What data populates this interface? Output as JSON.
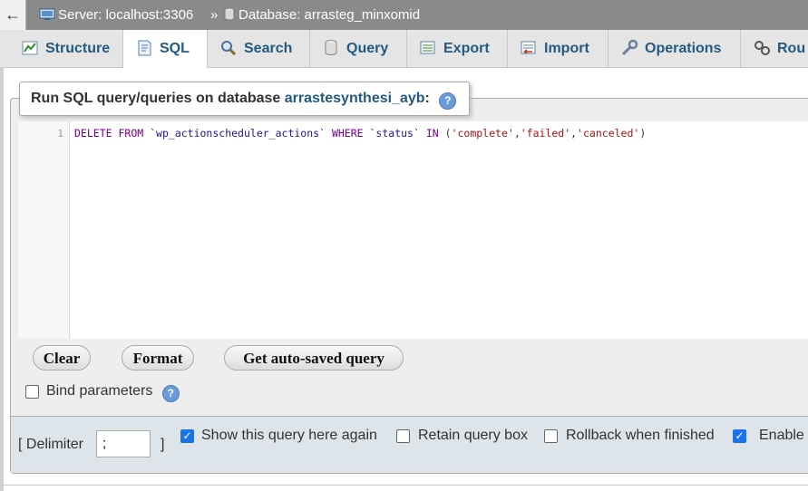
{
  "breadcrumb": {
    "back_label": "←",
    "server": "Server: localhost:3306",
    "separator": "»",
    "database": "Database: arrasteg_minxomid"
  },
  "tabs": [
    {
      "label": "Structure",
      "icon": "structure-icon",
      "active": false
    },
    {
      "label": "SQL",
      "icon": "sql-icon",
      "active": true
    },
    {
      "label": "Search",
      "icon": "search-icon",
      "active": false
    },
    {
      "label": "Query",
      "icon": "query-icon",
      "active": false
    },
    {
      "label": "Export",
      "icon": "export-icon",
      "active": false
    },
    {
      "label": "Import",
      "icon": "import-icon",
      "active": false
    },
    {
      "label": "Operations",
      "icon": "operations-icon",
      "active": false
    },
    {
      "label": "Rou",
      "icon": "routines-icon",
      "active": false
    }
  ],
  "panel": {
    "title_prefix": "Run SQL query/queries on database",
    "db_name": "arrastesynthesi_ayb",
    "title_suffix": ":",
    "help_glyph": "?"
  },
  "editor": {
    "line_number": "1",
    "tokens": {
      "t1": "DELETE",
      "t2": "FROM",
      "t3": "`wp_actionscheduler_actions`",
      "t4": "WHERE",
      "t5": "`status`",
      "t6": "IN",
      "t7": "(",
      "t8": "'complete'",
      "t9": ",",
      "t10": "'failed'",
      "t11": ",",
      "t12": "'canceled'",
      "t13": ")"
    }
  },
  "buttons": {
    "clear": "Clear",
    "format": "Format",
    "autosaved": "Get auto-saved query"
  },
  "bind_parameters": {
    "label": "Bind parameters",
    "checked": false
  },
  "options": {
    "delimiter_label": "[ Delimiter",
    "delimiter_value": ";",
    "delimiter_close": "]",
    "show_query_label": "Show this query here again",
    "show_query_checked": true,
    "retain_label": "Retain query box",
    "retain_checked": false,
    "rollback_label": "Rollback when finished",
    "rollback_checked": false,
    "enable_label": "Enable",
    "enable_checked": true,
    "check_glyph": "✓"
  },
  "colors": {
    "accent": "#235a81",
    "checkbox_checked": "#1a73e8",
    "topbar": "#8a8a8a"
  }
}
